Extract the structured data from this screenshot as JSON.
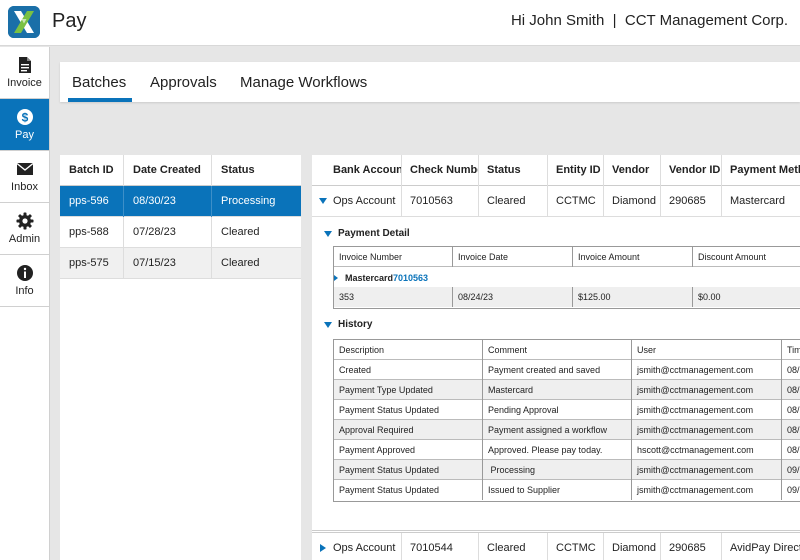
{
  "header": {
    "app_title": "Pay",
    "greeting": "Hi John Smith  |  CCT Management Corp."
  },
  "sidebar": {
    "items": [
      {
        "label": "Invoice",
        "icon": "document-icon",
        "active": false
      },
      {
        "label": "Pay",
        "icon": "dollar-icon",
        "active": true
      },
      {
        "label": "Inbox",
        "icon": "envelope-icon",
        "active": false
      },
      {
        "label": "Admin",
        "icon": "gear-icon",
        "active": false
      },
      {
        "label": "Info",
        "icon": "info-icon",
        "active": false
      }
    ]
  },
  "tabs": [
    {
      "label": "Batches",
      "active": true
    },
    {
      "label": "Approvals",
      "active": false
    },
    {
      "label": "Manage Workflows",
      "active": false
    }
  ],
  "batches": {
    "headers": [
      "Batch ID",
      "Date Created",
      "Status"
    ],
    "rows": [
      [
        "pps-596",
        "08/30/23",
        "Processing"
      ],
      [
        "pps-588",
        "07/28/23",
        "Cleared"
      ],
      [
        "pps-575",
        "07/15/23",
        "Cleared"
      ]
    ]
  },
  "payments": {
    "headers": [
      "Bank Account",
      "Check Number",
      "Status",
      "Entity ID",
      "Vendor",
      "Vendor ID",
      "Payment Method"
    ],
    "rows": [
      [
        "Ops Account",
        "7010563",
        "Cleared",
        "CCTMC",
        "Diamond",
        "290685",
        "Mastercard"
      ],
      [
        "Ops Account",
        "7010544",
        "Cleared",
        "CCTMC",
        "Diamond",
        "290685",
        "AvidPay Direct"
      ]
    ]
  },
  "payment_detail": {
    "title": "Payment Detail",
    "headers": [
      "Invoice Number",
      "Invoice Date",
      "Invoice Amount",
      "Discount Amount"
    ],
    "group_label": "Mastercard",
    "group_number": "7010563",
    "rows": [
      [
        "353",
        "08/24/23",
        "$125.00",
        "$0.00"
      ]
    ]
  },
  "history": {
    "title": "History",
    "headers": [
      "Description",
      "Comment",
      "User",
      "Tim"
    ],
    "rows": [
      [
        "Created",
        "Payment created and saved",
        "jsmith@cctmanagement.com",
        "08/"
      ],
      [
        "Payment Type Updated",
        "Mastercard",
        "jsmith@cctmanagement.com",
        "08/"
      ],
      [
        "Payment Status Updated",
        "Pending Approval",
        "jsmith@cctmanagement.com",
        "08/"
      ],
      [
        "Approval Required",
        "Payment assigned a workflow",
        "jsmith@cctmanagement.com",
        "08/"
      ],
      [
        "Payment Approved",
        "Approved. Please pay today.",
        "hscott@cctmanagement.com",
        "08/"
      ],
      [
        "Payment Status Updated",
        " Processing",
        "jsmith@cctmanagement.com",
        "09/"
      ],
      [
        "Payment Status Updated",
        "Issued to Supplier",
        "jsmith@cctmanagement.com",
        "09/"
      ]
    ]
  },
  "colors": {
    "accent": "#0a73ba",
    "logo_green": "#7ac143"
  }
}
